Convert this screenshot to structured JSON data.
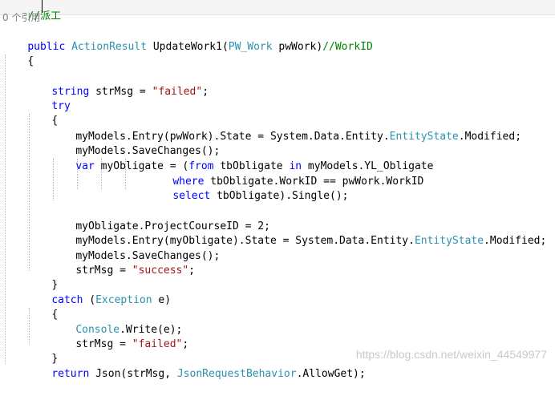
{
  "colors": {
    "keyword": "#0000ff",
    "type": "#2b91af",
    "string": "#a31515",
    "comment": "#008000",
    "codelens": "#808080",
    "watermark": "#c9c9c9"
  },
  "editor": {
    "comment_top": "//派工",
    "codelens": "0 个引用",
    "l3_kw1": "public",
    "l3_type1": "ActionResult",
    "l3_plain1": " UpdateWork1(",
    "l3_type2": "PW_Work",
    "l3_plain2": " pwWork)",
    "l3_comment": "//WorkID",
    "brace_open": "{",
    "brace_close": "}",
    "l5_kw": "string",
    "l5_plain": " strMsg = ",
    "l5_str": "\"failed\"",
    "semicolon": ";",
    "try_kw": "try",
    "entry_line_plain": "myModels.Entry(pwWork).State = System.Data.Entity.",
    "entity_state": "EntityState",
    "modified_tail": ".Modified;",
    "save_changes": "myModels.SaveChanges();",
    "var_kw": "var",
    "var_plain1": " myObligate = (",
    "from_kw": "from",
    "var_plain2": " tbObligate ",
    "in_kw": "in",
    "var_plain3": " myModels.YL_Obligate",
    "where_kw": "where",
    "where_plain": " tbObligate.WorkID == pwWork.WorkID",
    "select_kw": "select",
    "select_plain": " tbObligate).Single();",
    "project_course": "myObligate.ProjectCourseID = 2;",
    "entry2_plain": "myModels.Entry(myObligate).State = System.Data.Entity.",
    "strmsg_assign": "strMsg = ",
    "success_str": "\"success\"",
    "catch_kw": "catch",
    "catch_plain1": " (",
    "exception_type": "Exception",
    "catch_plain2": " e)",
    "console_type": "Console",
    "console_plain": ".Write(e);",
    "failed_str": "\"failed\"",
    "return_kw": "return",
    "return_plain1": " Json(strMsg, ",
    "json_behavior_type": "JsonRequestBehavior",
    "return_plain2": ".AllowGet);"
  },
  "watermark": "https://blog.csdn.net/weixin_44549977"
}
